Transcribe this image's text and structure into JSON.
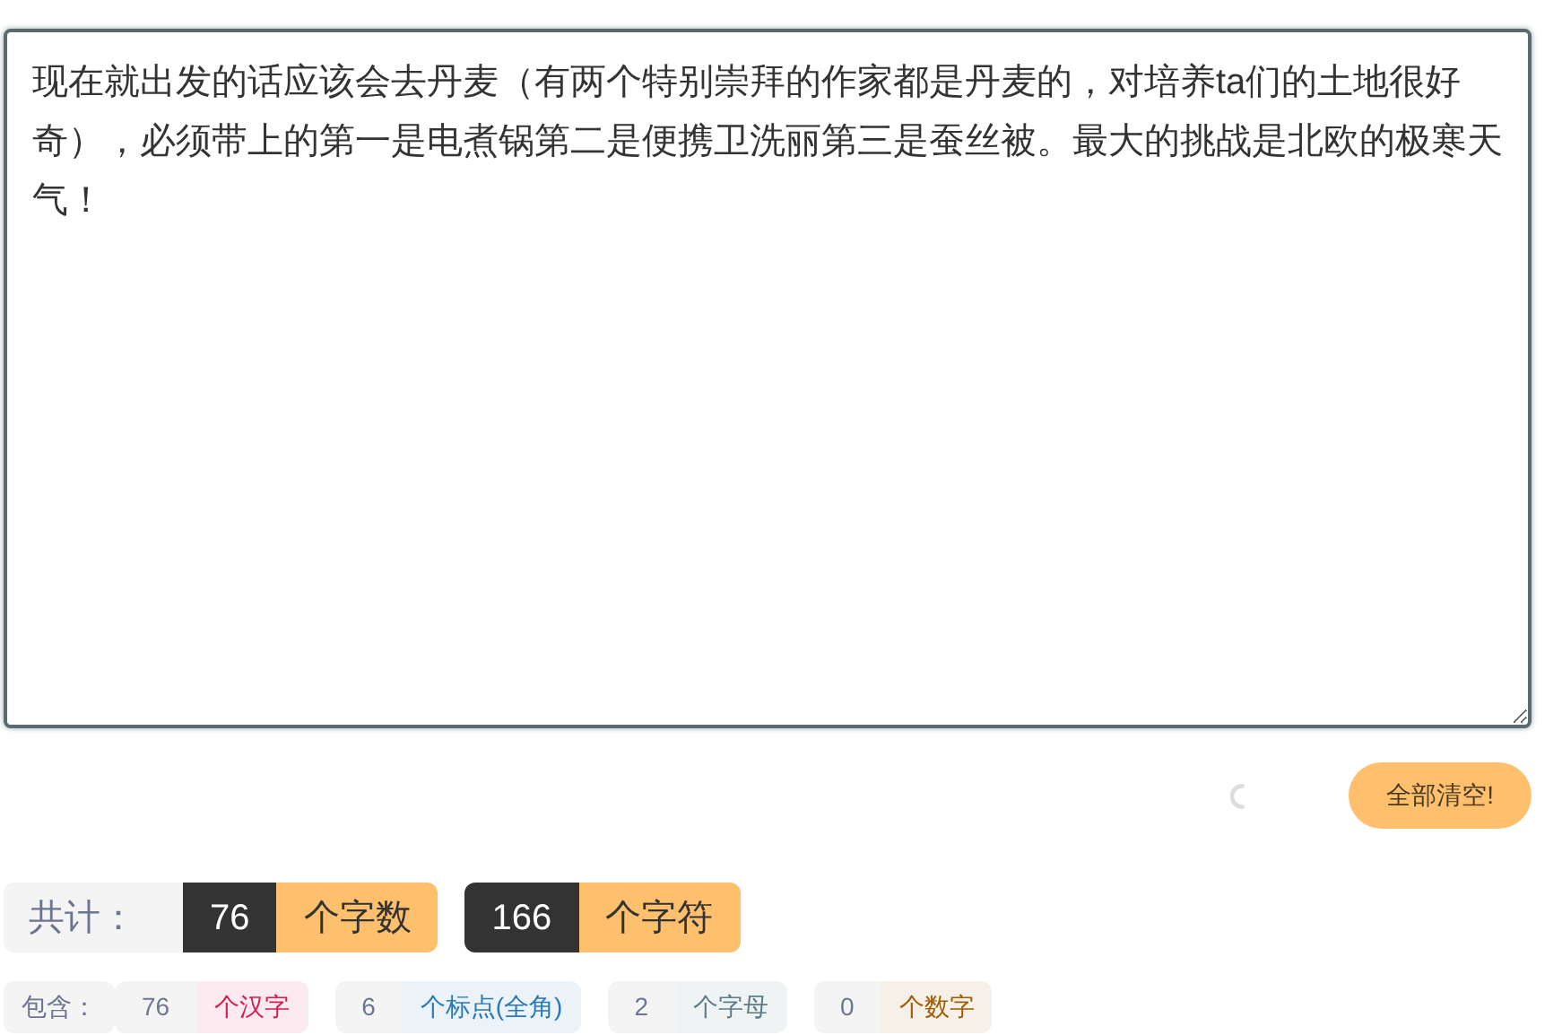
{
  "editor": {
    "value": "现在就出发的话应该会去丹麦（有两个特别崇拜的作家都是丹麦的，对培养ta们的土地很好奇），必须带上的第一是电煮锅第二是便携卫洗丽第三是蚕丝被。最大的挑战是北欧的极寒天气！"
  },
  "clear_button": "全部清空!",
  "totals": {
    "label": "共计：",
    "items": [
      {
        "value": "76",
        "unit": "个字数"
      },
      {
        "value": "166",
        "unit": "个字符"
      }
    ]
  },
  "breakdown": {
    "label": "包含：",
    "items": [
      {
        "value": "76",
        "unit": "个汉字",
        "color": "#d81b4f"
      },
      {
        "value": "6",
        "unit": "个标点(全角)",
        "color": "#2a78b5"
      },
      {
        "value": "2",
        "unit": "个字母",
        "color": "#5c7c86"
      },
      {
        "value": "0",
        "unit": "个数字",
        "color": "#a05c00"
      }
    ]
  }
}
